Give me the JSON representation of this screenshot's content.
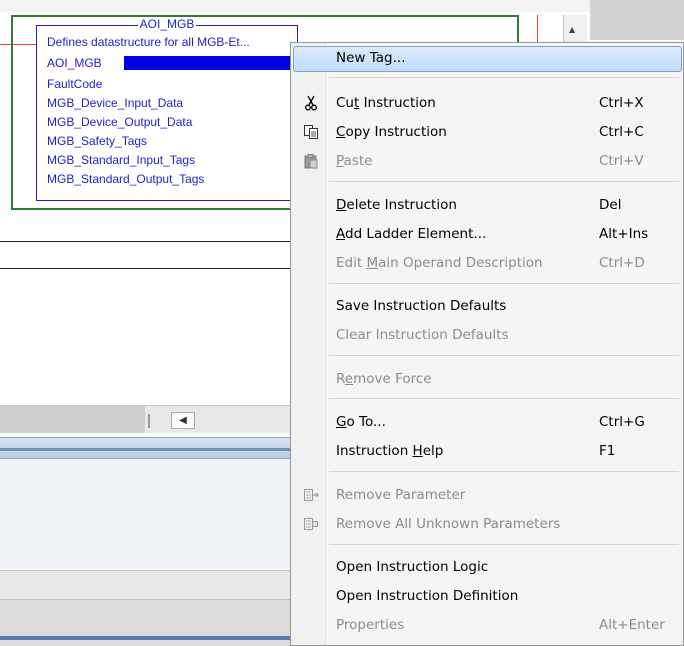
{
  "aoi": {
    "title": "AOI_MGB",
    "description": "Defines datastructure for all MGB-Et",
    "description_tail": "...",
    "tag_name": "AOI_MGB",
    "parameters": [
      "FaultCode",
      "MGB_Device_Input_Data",
      "MGB_Device_Output_Data",
      "MGB_Safety_Tags",
      "MGB_Standard_Input_Tags",
      "MGB_Standard_Output_Tags"
    ]
  },
  "menu": {
    "new_tag": "New Tag...",
    "cut": {
      "pre": "Cu",
      "key": "t",
      "post": " Instruction",
      "shortcut": "Ctrl+X"
    },
    "copy": {
      "pre": "",
      "key": "C",
      "post": "opy Instruction",
      "shortcut": "Ctrl+C"
    },
    "paste": {
      "pre": "",
      "key": "P",
      "post": "aste",
      "shortcut": "Ctrl+V"
    },
    "delete": {
      "pre": "",
      "key": "D",
      "post": "elete Instruction",
      "shortcut": "Del"
    },
    "add_ladder": {
      "pre": "",
      "key": "A",
      "post": "dd Ladder Element...",
      "shortcut": "Alt+Ins"
    },
    "edit_operand": {
      "pre": "Edit ",
      "key": "M",
      "post": "ain Operand Description",
      "shortcut": "Ctrl+D"
    },
    "save_defaults": "Save Instruction Defaults",
    "clear_defaults": "Clear Instruction Defaults",
    "remove_force": {
      "pre": "R",
      "key": "e",
      "post": "move Force"
    },
    "go_to": {
      "pre": "",
      "key": "G",
      "post": "o To...",
      "shortcut": "Ctrl+G"
    },
    "help": {
      "pre": "Instruction ",
      "key": "H",
      "post": "elp",
      "shortcut": "F1"
    },
    "remove_param": "Remove Parameter",
    "remove_all_unknown": "Remove All Unknown Parameters",
    "open_logic": "Open Instruction Logic",
    "open_definition": "Open Instruction Definition",
    "properties": {
      "label": "Properties",
      "shortcut": "Alt+Enter"
    }
  },
  "icons": {
    "cut": "scissors-icon",
    "copy": "copy-icon",
    "paste": "paste-icon",
    "remove_param": "remove-parameter-icon",
    "remove_all": "remove-all-parameters-icon"
  }
}
